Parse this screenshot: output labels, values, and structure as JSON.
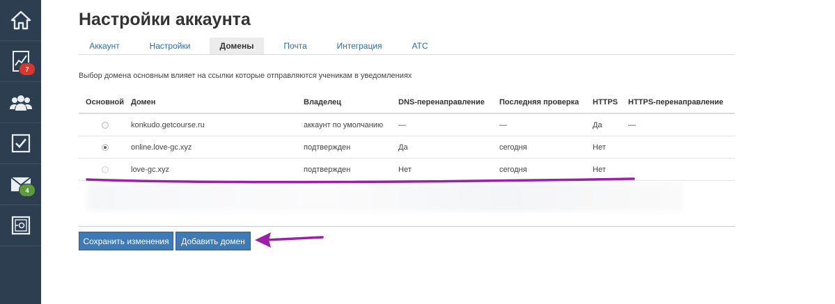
{
  "sidebar": {
    "items": [
      {
        "icon": "home-icon"
      },
      {
        "icon": "chart-icon",
        "badge": "7",
        "badge_color": "#d9372e"
      },
      {
        "icon": "users-icon"
      },
      {
        "icon": "tasks-checkbox-icon"
      },
      {
        "icon": "mail-icon",
        "badge": "4",
        "badge_color": "#5c9a3a"
      },
      {
        "icon": "safe-icon"
      }
    ]
  },
  "page": {
    "title": "Настройки аккаунта",
    "note": "Выбор домена основным влияет на ссылки которые отправляются ученикам в уведомлениях"
  },
  "tabs": [
    {
      "label": "Аккаунт",
      "active": false
    },
    {
      "label": "Настройки",
      "active": false
    },
    {
      "label": "Домены",
      "active": true
    },
    {
      "label": "Почта",
      "active": false
    },
    {
      "label": "Интеграция",
      "active": false
    },
    {
      "label": "АТС",
      "active": false
    }
  ],
  "table": {
    "headers": [
      "Основной",
      "Домен",
      "Владелец",
      "DNS-перенаправление",
      "Последняя проверка",
      "HTTPS",
      "HTTPS-перенаправление"
    ],
    "rows": [
      {
        "selected": false,
        "domain": "konkudo.getcourse.ru",
        "domain_link": false,
        "owner": "аккаунт по умолчанию",
        "dns": "—",
        "last_check": "—",
        "https": "Да",
        "https_link": false,
        "https_redirect": "—"
      },
      {
        "selected": true,
        "domain": "online.love-gc.xyz",
        "domain_link": true,
        "owner": "подтвержден",
        "dns": "Да",
        "last_check": "сегодня",
        "https": "Нет",
        "https_link": true,
        "https_redirect": ""
      },
      {
        "selected": false,
        "domain": "love-gc.xyz",
        "domain_link": true,
        "owner": "подтвержден",
        "dns": "Нет",
        "last_check": "сегодня",
        "https": "Нет",
        "https_link": true,
        "https_redirect": ""
      }
    ]
  },
  "buttons": {
    "save": "Сохранить изменения",
    "add_domain": "Добавить домен"
  },
  "colors": {
    "sidebar_bg": "#2d3e50",
    "link": "#2c6fa8",
    "button": "#3d7ab6",
    "annotation": "#9b1fa8"
  }
}
